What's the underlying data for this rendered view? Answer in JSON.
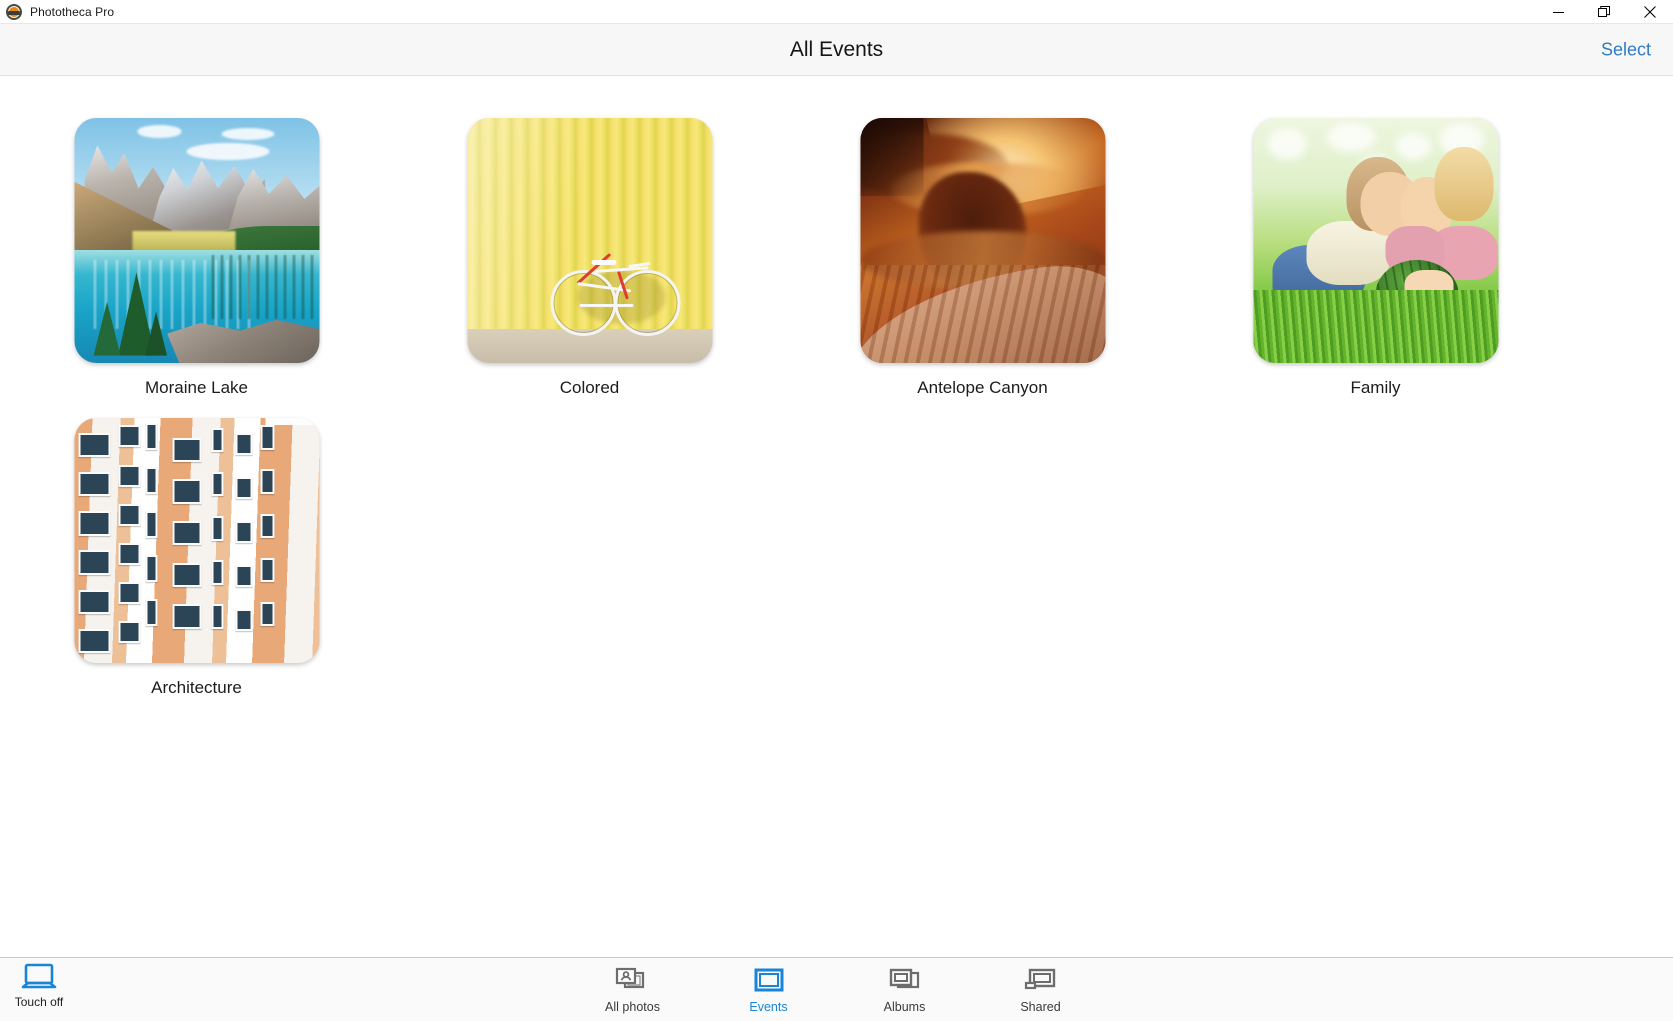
{
  "window": {
    "app_title": "Phototheca Pro",
    "app_icon": "phototheca-logo-icon",
    "minimize_label": "Minimize",
    "restore_label": "Restore",
    "close_label": "Close"
  },
  "header": {
    "title": "All Events",
    "select_label": "Select"
  },
  "events": [
    {
      "name": "Moraine Lake",
      "art": "moraine-lake"
    },
    {
      "name": "Colored",
      "art": "yellow-wall-bicycle"
    },
    {
      "name": "Antelope Canyon",
      "art": "antelope-canyon"
    },
    {
      "name": "Family",
      "art": "children-watermelon"
    },
    {
      "name": "Architecture",
      "art": "apartment-facade"
    }
  ],
  "bottom_bar": {
    "touch": {
      "label": "Touch off",
      "icon": "laptop-icon"
    },
    "nav": [
      {
        "label": "All photos",
        "icon": "photos-stack-icon",
        "active": false
      },
      {
        "label": "Events",
        "icon": "single-frame-icon",
        "active": true
      },
      {
        "label": "Albums",
        "icon": "frames-stack-icon",
        "active": false
      },
      {
        "label": "Shared",
        "icon": "shared-frame-icon",
        "active": false
      }
    ]
  },
  "colors": {
    "accent": "#1a85d6",
    "link": "#2d7cc4",
    "header_bg": "#f7f7f7",
    "bottom_bg": "#fafafa",
    "text": "#1c1c1c",
    "icon_ink": "#6d6d6d"
  }
}
